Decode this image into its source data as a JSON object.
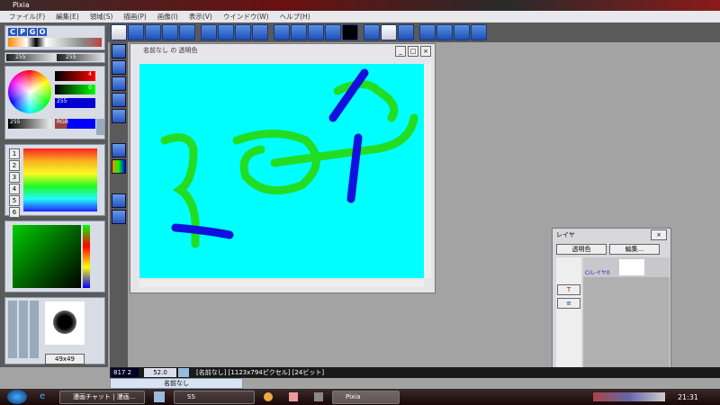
{
  "app": {
    "title": "Pixia"
  },
  "menu": [
    "ファイル(F)",
    "編集(E)",
    "領域(S)",
    "描画(P)",
    "画像(I)",
    "表示(V)",
    "ウインドウ(W)",
    "ヘルプ(H)"
  ],
  "left": {
    "tabs": [
      "C",
      "P",
      "G",
      "O"
    ],
    "t_value": "255",
    "d_value": "255",
    "red": "4",
    "green": "0",
    "blue": "255",
    "gray": "255",
    "mode": "RGB",
    "palette_rows": [
      "1",
      "2",
      "3",
      "4",
      "5",
      "6"
    ],
    "brush_size": "49x49"
  },
  "canvas_window": {
    "title": "名前なし の 透明色"
  },
  "status": {
    "coords": "817 2",
    "zoom": "52.0",
    "info": "[名前なし] [1123x794ピクセル] [24ビット]"
  },
  "doc_tab": "名前なし",
  "layer": {
    "title": "レイヤ",
    "transparent_btn": "透明色",
    "edit_btn": "編集...",
    "layer_name": "CIレイヤ0"
  },
  "taskbar": {
    "items": [
      "漫画チャット | 漫画...",
      "SS",
      "Pixia"
    ],
    "clock": "21:31"
  }
}
